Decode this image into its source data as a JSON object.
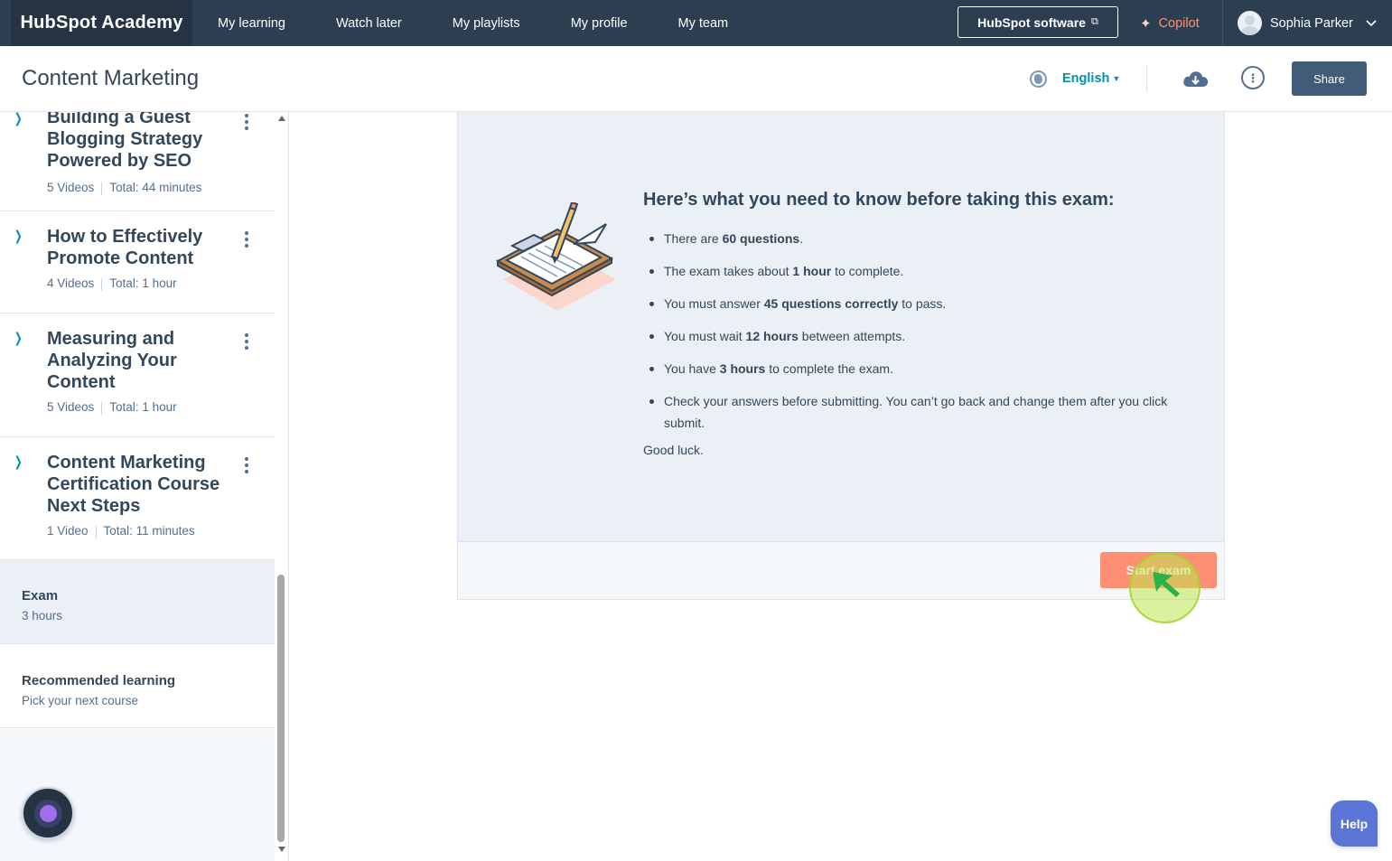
{
  "topnav": {
    "logo": "HubSpot Academy",
    "links": [
      "My learning",
      "Watch later",
      "My playlists",
      "My profile",
      "My team"
    ],
    "software_label": "HubSpot software",
    "copilot_label": "Copilot",
    "user_name": "Sophia Parker"
  },
  "header": {
    "course_title": "Content Marketing",
    "language": "English",
    "share_label": "Share"
  },
  "sidebar": {
    "sections": [
      {
        "title": "Building a Guest Blogging Strategy Powered by SEO",
        "videos": "5 Videos",
        "total": "Total: 44 minutes"
      },
      {
        "title": "How to Effectively Promote Content",
        "videos": "4 Videos",
        "total": "Total: 1 hour"
      },
      {
        "title": "Measuring and Analyzing Your Content",
        "videos": "5 Videos",
        "total": "Total: 1 hour"
      },
      {
        "title": "Content Marketing Certification Course Next Steps",
        "videos": "1 Video",
        "total": "Total: 11 minutes"
      }
    ],
    "exam": {
      "title": "Exam",
      "duration": "3 hours"
    },
    "recommended": {
      "title": "Recommended learning",
      "subtitle": "Pick your next course"
    }
  },
  "exam_card": {
    "heading": "Here’s what you need to know before taking this exam:",
    "rules": [
      {
        "pre": "There are ",
        "bold": "60 questions",
        "post": "."
      },
      {
        "pre": "The exam takes about ",
        "bold": "1 hour",
        "post": " to complete."
      },
      {
        "pre": "You must answer ",
        "bold": "45 questions correctly",
        "post": " to pass."
      },
      {
        "pre": "You must wait ",
        "bold": "12 hours",
        "post": " between attempts."
      },
      {
        "pre": "You have ",
        "bold": "3 hours",
        "post": " to complete the exam."
      },
      {
        "pre": "Check your answers before submitting. You can’t go back and change them after you click submit.",
        "bold": "",
        "post": ""
      }
    ],
    "closing": "Good luck.",
    "start_label": "Start exam"
  },
  "help_label": "Help",
  "colors": {
    "nav_bg": "#2d3e50",
    "accent_teal": "#0091ae",
    "start_button": "#ff8f73",
    "share_button": "#425b76",
    "help_button": "#5a75d6"
  },
  "icons": [
    "external-link-icon",
    "sparkle-icon",
    "chevron-down-icon",
    "globe-icon",
    "cloud-download-icon",
    "more-info-icon",
    "chevron-right-icon",
    "kebab-menu-icon",
    "clipboard-illustration",
    "chatbot-icon"
  ]
}
